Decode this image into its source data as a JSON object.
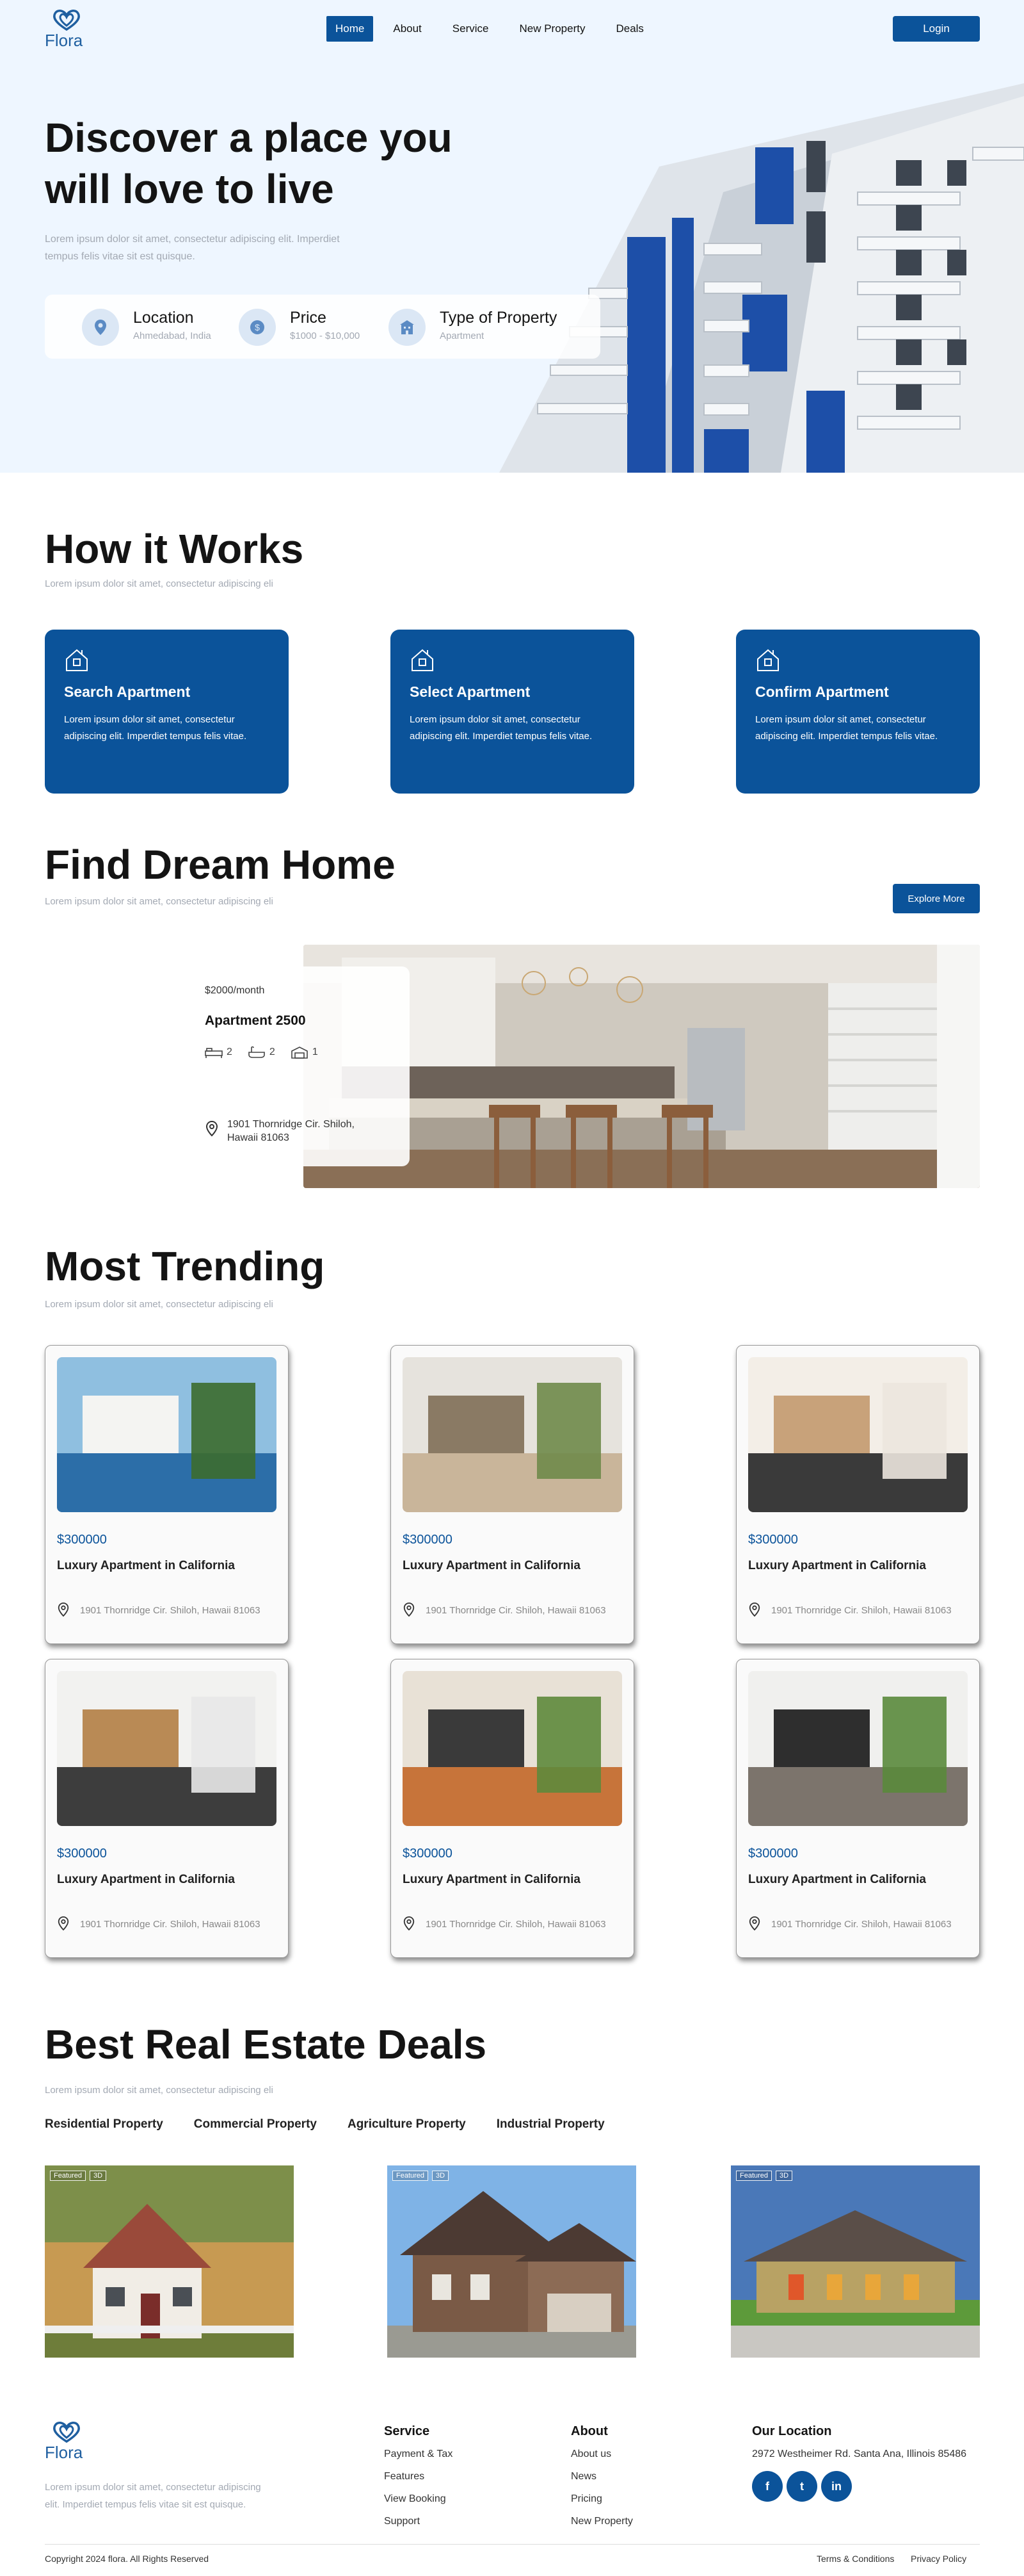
{
  "brand": {
    "name": "Flora"
  },
  "nav": {
    "items": [
      "Home",
      "About",
      "Service",
      "New Property",
      "Deals"
    ],
    "active": "Home",
    "login_label": "Login"
  },
  "hero": {
    "title": "Discover a place you will love to live",
    "subtitle": "Lorem ipsum dolor sit amet, consectetur adipiscing elit. Imperdiet tempus felis vitae sit est quisque.",
    "search": [
      {
        "label": "Location",
        "value": "Ahmedabad, India",
        "icon": "location-pin-icon"
      },
      {
        "label": "Price",
        "value": "$1000 - $10,000",
        "icon": "dollar-coin-icon"
      },
      {
        "label": "Type of Property",
        "value": "Apartment",
        "icon": "building-icon"
      }
    ]
  },
  "how_it_works": {
    "title": "How it Works",
    "subtitle": "Lorem ipsum dolor sit amet, consectetur adipiscing eli",
    "cards": [
      {
        "title": "Search Apartment",
        "text": "Lorem ipsum dolor sit amet, consectetur adipiscing elit. Imperdiet tempus felis vitae.",
        "icon": "home-search-icon"
      },
      {
        "title": "Select Apartment",
        "text": "Lorem ipsum dolor sit amet, consectetur adipiscing elit. Imperdiet tempus felis vitae.",
        "icon": "home-select-icon"
      },
      {
        "title": "Confirm Apartment",
        "text": "Lorem ipsum dolor sit amet, consectetur adipiscing elit. Imperdiet tempus felis vitae.",
        "icon": "home-confirm-icon"
      }
    ]
  },
  "dream_home": {
    "title": "Find Dream Home",
    "subtitle": "Lorem ipsum dolor sit amet, consectetur adipiscing eli",
    "explore_label": "Explore More",
    "featured": {
      "price": "$2000/month",
      "name": "Apartment 2500",
      "beds": "2",
      "baths": "2",
      "garage": "1",
      "address": "1901 Thornridge Cir. Shiloh, Hawaii 81063"
    }
  },
  "trending": {
    "title": "Most Trending",
    "subtitle": "Lorem ipsum dolor sit amet, consectetur adipiscing eli",
    "cards": [
      {
        "price": "$300000",
        "name": "Luxury Apartment in California",
        "address": "1901 Thornridge Cir. Shiloh, Hawaii 81063"
      },
      {
        "price": "$300000",
        "name": "Luxury Apartment in California",
        "address": "1901 Thornridge Cir. Shiloh, Hawaii 81063"
      },
      {
        "price": "$300000",
        "name": "Luxury Apartment in California",
        "address": "1901 Thornridge Cir. Shiloh, Hawaii 81063"
      },
      {
        "price": "$300000",
        "name": "Luxury Apartment in California",
        "address": "1901 Thornridge Cir. Shiloh, Hawaii 81063"
      },
      {
        "price": "$300000",
        "name": "Luxury Apartment in California",
        "address": "1901 Thornridge Cir. Shiloh, Hawaii 81063"
      },
      {
        "price": "$300000",
        "name": "Luxury Apartment in California",
        "address": "1901 Thornridge Cir. Shiloh, Hawaii 81063"
      }
    ]
  },
  "deals": {
    "title": "Best Real Estate Deals",
    "subtitle": "Lorem ipsum dolor sit amet, consectetur adipiscing eli",
    "tabs": [
      "Residential Property",
      "Commercial Property",
      "Agriculture Property",
      "Industrial Property"
    ],
    "badges": [
      "Featured",
      "3D"
    ]
  },
  "footer": {
    "about": "Lorem ipsum dolor sit amet, consectetur adipiscing elit. Imperdiet tempus felis vitae sit est quisque.",
    "service_title": "Service",
    "service_links": [
      "Payment & Tax",
      "Features",
      "View Booking",
      "Support"
    ],
    "about_title": "About",
    "about_links": [
      "About us",
      "News",
      "Pricing",
      "New Property"
    ],
    "location_title": "Our Location",
    "address": "2972 Westheimer Rd. Santa Ana, Illinois 85486",
    "social": [
      {
        "label": "f",
        "icon": "facebook-icon"
      },
      {
        "label": "t",
        "icon": "twitter-icon"
      },
      {
        "label": "in",
        "icon": "linkedin-icon"
      }
    ],
    "copyright": "Copyright 2024 flora. All Rights Reserved",
    "terms": "Terms & Conditions",
    "privacy": "Privacy Policy"
  },
  "colors": {
    "primary": "#0b539a",
    "hero_bg": "#eef6ff",
    "muted": "#a3a9b3"
  }
}
